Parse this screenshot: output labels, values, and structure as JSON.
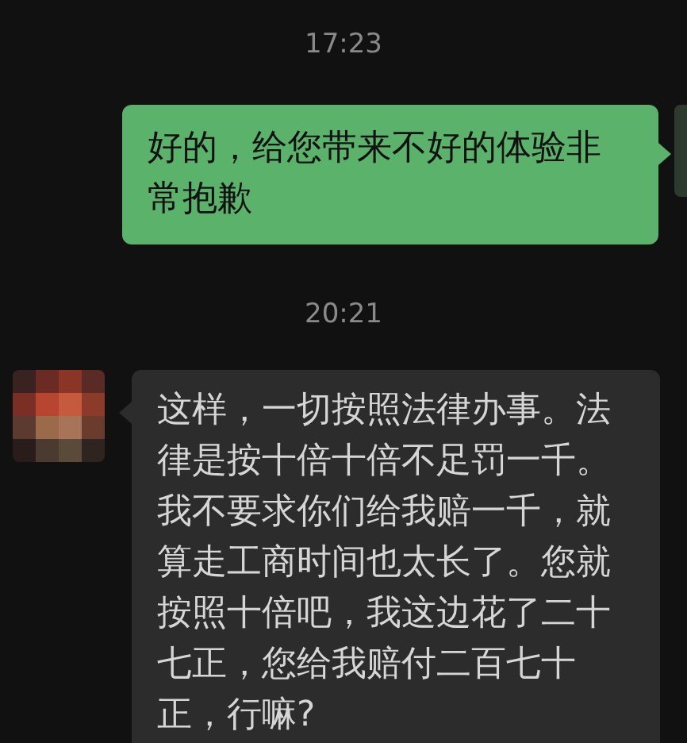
{
  "messages": [
    {
      "kind": "time",
      "text": "17:23"
    },
    {
      "kind": "outgoing",
      "text": "好的，给您带来不好的体验非常抱歉"
    },
    {
      "kind": "time",
      "text": "20:21"
    },
    {
      "kind": "incoming",
      "text": "这样，一切按照法律办事。法律是按十倍十倍不足罚一千。我不要求你们给我赔一千，就算走工商时间也太长了。您就按照十倍吧，我这边花了二十七正，您给我赔付二百七十正，行嘛?"
    }
  ]
}
